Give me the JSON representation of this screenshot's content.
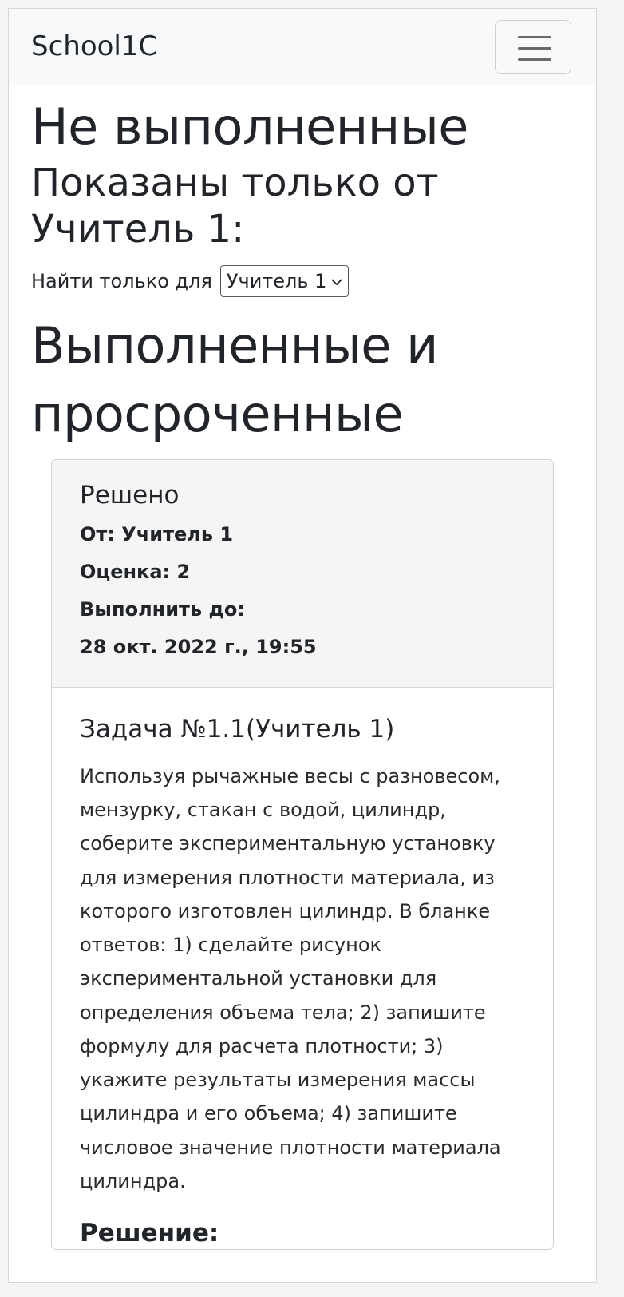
{
  "navbar": {
    "brand": "School1C",
    "menu_icon": "hamburger-menu-icon"
  },
  "heading_not_completed": "Не выполненные",
  "filter_heading": "Показаны только от Учитель 1:",
  "filter": {
    "label": "Найти только для",
    "selected": "Учитель 1",
    "chevron_icon": "chevron-down-icon"
  },
  "heading_completed": "Выполненные и просроченные",
  "task_card": {
    "status": "Решено",
    "from": "От: Учитель 1",
    "grade": "Оценка: 2",
    "due_label": "Выполнить до:",
    "due_date": "28 окт. 2022 г., 19:55",
    "title": "Задача №1.1(Учитель 1)",
    "description": "Используя рычажные весы с разновесом, мензурку, стакан с водой, цилиндр, соберите экспериментальную установку для измерения плотности материала, из которого изготовлен цилиндр. В бланке ответов: 1) сделайте рисунок экспериментальной установки для определения объема тела; 2) запишите формулу для расчета плотности; 3) укажите результаты измерения массы цилиндра и его объема; 4) запишите числовое значение плотности материала цилиндра.",
    "solution_title": "Решение:"
  }
}
